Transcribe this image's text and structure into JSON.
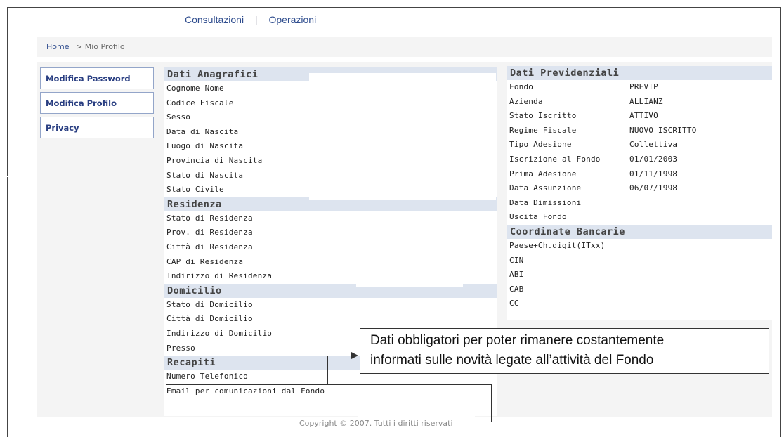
{
  "topnav": {
    "consultazioni": "Consultazioni",
    "separator": "|",
    "operazioni": "Operazioni"
  },
  "breadcrumb": {
    "home": "Home",
    "current": "> Mio Profilo"
  },
  "sidebar": {
    "items": [
      {
        "label": "Modifica Password"
      },
      {
        "label": "Modifica Profilo"
      },
      {
        "label": "Privacy"
      }
    ]
  },
  "anagrafici": {
    "title": "Dati Anagrafici",
    "fields": [
      "Cognome Nome",
      "Codice Fiscale",
      "Sesso",
      "Data di Nascita",
      "Luogo di Nascita",
      "Provincia di Nascita",
      "Stato di Nascita",
      "Stato Civile"
    ]
  },
  "residenza": {
    "title": "Residenza",
    "fields": [
      "Stato di Residenza",
      "Prov. di Residenza",
      "Città di Residenza",
      "CAP di Residenza",
      "Indirizzo di Residenza"
    ]
  },
  "domicilio": {
    "title": "Domicilio",
    "fields": [
      "Stato di Domicilio",
      "Città di Domicilio",
      "Indirizzo di Domicilio",
      "Presso"
    ]
  },
  "recapiti": {
    "title": "Recapiti",
    "fields": [
      "Numero Telefonico",
      "Email per comunicazioni dal Fondo"
    ]
  },
  "previdenziali": {
    "title": "Dati Previdenziali",
    "rows": [
      {
        "label": "Fondo",
        "value": "PREVIP"
      },
      {
        "label": "Azienda",
        "value": "ALLIANZ"
      },
      {
        "label": "Stato Iscritto",
        "value": "ATTIVO"
      },
      {
        "label": "Regime Fiscale",
        "value": "NUOVO ISCRITTO"
      },
      {
        "label": "Tipo Adesione",
        "value": "Collettiva"
      },
      {
        "label": "Iscrizione al Fondo",
        "value": "01/01/2003"
      },
      {
        "label": "Prima Adesione",
        "value": "01/11/1998"
      },
      {
        "label": "Data Assunzione",
        "value": "06/07/1998"
      },
      {
        "label": "Data Dimissioni",
        "value": ""
      },
      {
        "label": "Uscita Fondo",
        "value": ""
      }
    ]
  },
  "bancarie": {
    "title": "Coordinate Bancarie",
    "fields": [
      "Paese+Ch.digit(ITxx)",
      "CIN",
      "ABI",
      "CAB",
      "CC"
    ]
  },
  "callout": {
    "line1": "Dati obbligatori per poter rimanere costantemente",
    "line2": "informati sulle novità legate all’attività del Fondo"
  },
  "copyright": "Copyright © 2007. Tutti i diritti riservati"
}
